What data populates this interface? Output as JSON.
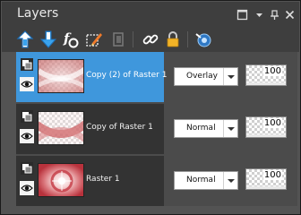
{
  "panel": {
    "title": "Layers",
    "controls": [
      "restore-icon",
      "menu-chevron-icon",
      "pin-icon",
      "close-icon"
    ]
  },
  "toolbar": {
    "tools": [
      "new-raster-layer-icon",
      "new-vector-layer-icon",
      "fx-effects-icon",
      "edit-selection-icon",
      "disabled-tool-icon",
      "link-layers-icon",
      "lock-layer-icon",
      "layer-properties-icon"
    ]
  },
  "layers": [
    {
      "name": "Copy (2) of Raster 1",
      "blend": "Overlay",
      "opacity": "100",
      "selected": true
    },
    {
      "name": "Copy of Raster 1",
      "blend": "Normal",
      "opacity": "100",
      "selected": false
    },
    {
      "name": "Raster 1",
      "blend": "Normal",
      "opacity": "100",
      "selected": false
    }
  ],
  "colors": {
    "selected": "#3f97dc",
    "panel_bg": "#535353",
    "row_bg": "#333333"
  }
}
